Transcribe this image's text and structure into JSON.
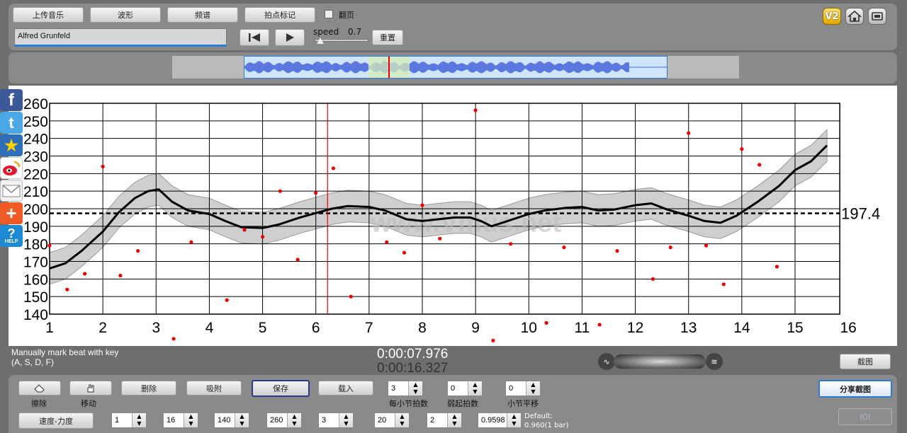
{
  "toolbar": {
    "upload": "上传音乐",
    "waveform": "波形",
    "spectrum": "频谱",
    "beat_mark": "拍点标记",
    "page_turn": "翻页",
    "song_name": "Alfred Grunfeld",
    "speed_label": "speed",
    "speed_value": "0.7",
    "speed_fraction": 0.7,
    "reset": "重置"
  },
  "status": {
    "hint_line1": "Manually mark beat with key",
    "hint_line2": "(A, S, D, F)",
    "time_current": "0:00:07.976",
    "time_total": "0:00:16.327",
    "screenshot": "截图"
  },
  "bottom": {
    "erase": "擦除",
    "move": "移动",
    "delete": "删除",
    "snap": "吸附",
    "save": "保存",
    "load": "载入",
    "beats_per_bar_value": "3",
    "beats_per_bar_label": "每小节拍数",
    "pickup_value": "0",
    "pickup_label": "弱起拍数",
    "bar_shift_value": "0",
    "bar_shift_label": "小节平移",
    "share": "分享截图",
    "ioi": "IOI",
    "tempo_dynamics": "速度-力度",
    "start_bar": "1",
    "end_bar": "16",
    "tempo_min": "140",
    "tempo_max": "260",
    "smoothing": "3",
    "curve_width": "20",
    "curve_thickness": "2",
    "ratio": "0.9598",
    "default_line1": "Default:",
    "default_line2": "0.960(1 bar)"
  },
  "sidebar": [
    "facebook",
    "twitter",
    "star",
    "weibo",
    "mail",
    "plus",
    "help"
  ],
  "help_label": "HELP",
  "watermark": "www.Vmus.net",
  "chart_data": {
    "type": "line+scatter",
    "xlim": [
      1,
      16
    ],
    "ylim": [
      140,
      260
    ],
    "x_ticks": [
      "1",
      "2",
      "3",
      "4",
      "5",
      "6",
      "7",
      "8",
      "9",
      "10",
      "11",
      "12",
      "13",
      "14",
      "15",
      "16"
    ],
    "y_ticks": [
      "140",
      "150",
      "160",
      "170",
      "180",
      "190",
      "200",
      "210",
      "220",
      "230",
      "240",
      "250",
      "260"
    ],
    "mean_label": "197.4",
    "mean": 197.4,
    "cursor_x": 6.22,
    "curve": [
      [
        1.0,
        166
      ],
      [
        1.3,
        169
      ],
      [
        1.6,
        176
      ],
      [
        2.0,
        187
      ],
      [
        2.3,
        198
      ],
      [
        2.6,
        206
      ],
      [
        2.85,
        210
      ],
      [
        3.05,
        211
      ],
      [
        3.3,
        204
      ],
      [
        3.6,
        199
      ],
      [
        4.0,
        197
      ],
      [
        4.3,
        193
      ],
      [
        4.6,
        189.5
      ],
      [
        5.0,
        189
      ],
      [
        5.3,
        191
      ],
      [
        5.7,
        195
      ],
      [
        6.0,
        197.5
      ],
      [
        6.3,
        200
      ],
      [
        6.6,
        201.5
      ],
      [
        7.0,
        201
      ],
      [
        7.3,
        199
      ],
      [
        7.7,
        194
      ],
      [
        8.0,
        193
      ],
      [
        8.3,
        194
      ],
      [
        8.6,
        195
      ],
      [
        8.9,
        195
      ],
      [
        9.1,
        193
      ],
      [
        9.3,
        190
      ],
      [
        9.6,
        193
      ],
      [
        10.0,
        197
      ],
      [
        10.3,
        199
      ],
      [
        10.7,
        200.5
      ],
      [
        11.0,
        201
      ],
      [
        11.3,
        199
      ],
      [
        11.6,
        199.5
      ],
      [
        12.0,
        202
      ],
      [
        12.3,
        203
      ],
      [
        12.6,
        199.5
      ],
      [
        13.0,
        196
      ],
      [
        13.3,
        193
      ],
      [
        13.6,
        192
      ],
      [
        13.9,
        196
      ],
      [
        14.3,
        204
      ],
      [
        14.7,
        213
      ],
      [
        15.0,
        222
      ],
      [
        15.3,
        227
      ],
      [
        15.6,
        236
      ]
    ],
    "band": 9,
    "points": [
      [
        1.0,
        179
      ],
      [
        1.33,
        154
      ],
      [
        1.66,
        163
      ],
      [
        2.0,
        224
      ],
      [
        2.33,
        162
      ],
      [
        2.66,
        176
      ],
      [
        3.33,
        126
      ],
      [
        3.66,
        181
      ],
      [
        4.33,
        148
      ],
      [
        4.66,
        188
      ],
      [
        5.0,
        184
      ],
      [
        5.33,
        210
      ],
      [
        5.66,
        171
      ],
      [
        6.0,
        209
      ],
      [
        6.33,
        223
      ],
      [
        6.66,
        150
      ],
      [
        7.33,
        181
      ],
      [
        7.66,
        175
      ],
      [
        8.0,
        202
      ],
      [
        8.33,
        183
      ],
      [
        9.0,
        256
      ],
      [
        9.33,
        125
      ],
      [
        9.66,
        180
      ],
      [
        10.33,
        135
      ],
      [
        10.66,
        178
      ],
      [
        11.33,
        134
      ],
      [
        11.66,
        176
      ],
      [
        12.33,
        160
      ],
      [
        12.66,
        178
      ],
      [
        13.0,
        243
      ],
      [
        13.33,
        179
      ],
      [
        13.66,
        157
      ],
      [
        14.0,
        234
      ],
      [
        14.33,
        225
      ],
      [
        14.66,
        167
      ]
    ]
  }
}
